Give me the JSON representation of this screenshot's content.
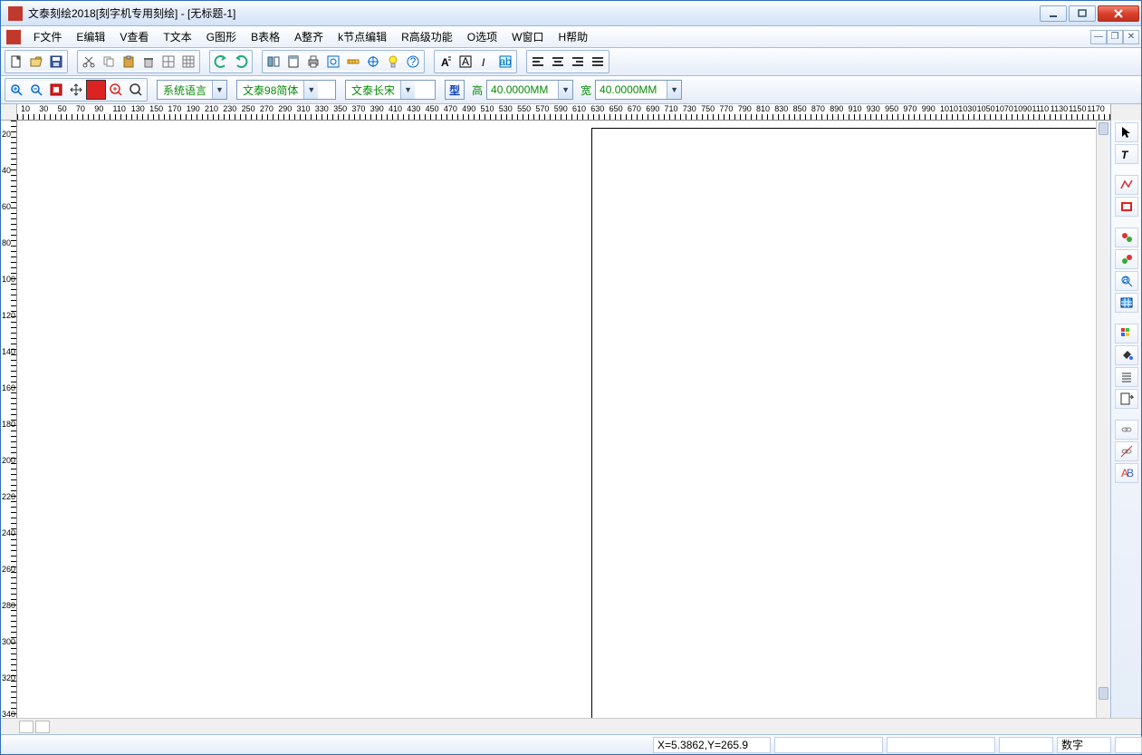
{
  "window": {
    "title": "文泰刻绘2018[刻字机专用刻绘] - [无标题-1]"
  },
  "menu": {
    "file": "F文件",
    "edit": "E编辑",
    "view": "V查看",
    "text": "T文本",
    "graphic": "G图形",
    "table": "B表格",
    "align": "A整齐",
    "node": "k节点编辑",
    "advanced": "R高级功能",
    "options": "O选项",
    "window": "W窗口",
    "help": "H帮助"
  },
  "toolbar2": {
    "lang_combo": "系统语言",
    "font_family": "文泰98简体",
    "font_style": "文泰长宋",
    "type_btn": "型",
    "height_label": "高",
    "height_value": "40.0000MM",
    "width_label": "宽",
    "width_value": "40.0000MM"
  },
  "ruler_h_ticks": [
    "10",
    "30",
    "50",
    "70",
    "90",
    "110",
    "130",
    "150",
    "170",
    "190",
    "210",
    "230",
    "250",
    "270",
    "290",
    "310",
    "330",
    "350",
    "370",
    "390",
    "410",
    "430",
    "450",
    "470",
    "490",
    "510",
    "530",
    "550",
    "570",
    "590",
    "610",
    "630",
    "650",
    "670",
    "690",
    "710",
    "730",
    "750",
    "770",
    "790",
    "810",
    "830",
    "850",
    "870",
    "890",
    "910",
    "930",
    "950",
    "970",
    "990",
    "1010",
    "1030",
    "1050",
    "1070",
    "1090",
    "1110",
    "1130",
    "1150",
    "1170"
  ],
  "ruler_v_ticks": [
    "20",
    "40",
    "60",
    "80",
    "100",
    "120",
    "140",
    "160",
    "180",
    "200",
    "220",
    "240",
    "260",
    "280",
    "300",
    "320",
    "340"
  ],
  "status": {
    "coords": "X=5.3862,Y=265.9",
    "num_label": "数字"
  },
  "icons": {
    "new": "new-file-icon",
    "open": "open-icon",
    "save": "save-icon",
    "cut": "cut-icon",
    "copy": "copy-icon",
    "paste": "paste-icon",
    "delete": "delete-icon",
    "grid1": "grid-icon",
    "grid2": "grid2-icon",
    "undo": "undo-icon",
    "redo": "redo-icon",
    "flip": "flip-icon",
    "page": "page-icon",
    "print": "print-icon",
    "zoomsel": "zoom-sel-icon",
    "measure": "measure-icon",
    "guide": "guide-icon",
    "tip": "tip-icon",
    "help": "help-icon",
    "bold": "bold-icon",
    "boxA": "boxed-a-icon",
    "italic": "italic-icon",
    "textedit": "text-edit-icon",
    "al": "align-left-icon",
    "ac": "align-center-icon",
    "ar": "align-right-icon",
    "aj": "align-justify-icon",
    "zin": "zoom-in-icon",
    "zout": "zoom-out-icon",
    "zsel": "zoom-select-icon",
    "pan": "pan-icon",
    "fill": "fill-red-icon",
    "zplus": "zoom-plus-icon",
    "zmag": "zoom-mag-icon"
  },
  "right_tools": {
    "arrow": "arrow-tool-icon",
    "text": "text-tool-icon",
    "kline": "polyline-tool-icon",
    "rect": "rect-tool-icon",
    "shape1": "shape-red-icon",
    "shape2": "shape-green-icon",
    "magic": "magic-icon",
    "table": "table-icon",
    "palette": "palette-icon",
    "bucket": "bucket-icon",
    "lines": "lines-icon",
    "export": "export-icon",
    "link1": "link-icon",
    "link2": "link2-icon",
    "ab": "ab-icon"
  }
}
